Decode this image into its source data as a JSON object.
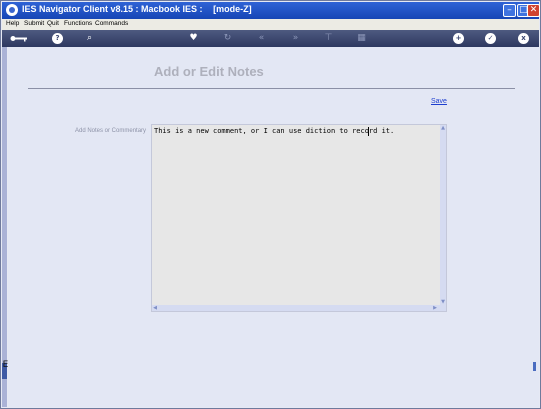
{
  "window": {
    "title": "IES Navigator Client v8.15 : Macbook IES :",
    "mode": "[mode-Z]",
    "controls": {
      "minimize": "–",
      "maximize": "□",
      "close": "✕"
    }
  },
  "menu": [
    "Help",
    "Submit",
    "Quit",
    "Functions",
    "Commands"
  ],
  "toolbar": {
    "icons": [
      "key-icon",
      "help-icon",
      "search-icon",
      "heart-icon",
      "refresh-icon",
      "rewind-icon",
      "fast-forward-icon",
      "tree-icon",
      "grid-icon",
      "add-icon",
      "check-icon",
      "close-icon"
    ],
    "help_glyph": "?",
    "search_glyph": "⌕",
    "heart_glyph": "♥",
    "refresh_glyph": "↻",
    "rewind_glyph": "«",
    "forward_glyph": "»",
    "tree_glyph": "⊤",
    "grid_glyph": "▦",
    "add_glyph": "+",
    "check_glyph": "✓",
    "close_glyph": "x"
  },
  "page": {
    "title": "Add or Edit Notes",
    "save_label": "Save",
    "field_label": "Add Notes or Commentary",
    "notes_value": "This is a new comment, or I can use diction to record it."
  },
  "sidebar": {
    "glyph": "E"
  }
}
